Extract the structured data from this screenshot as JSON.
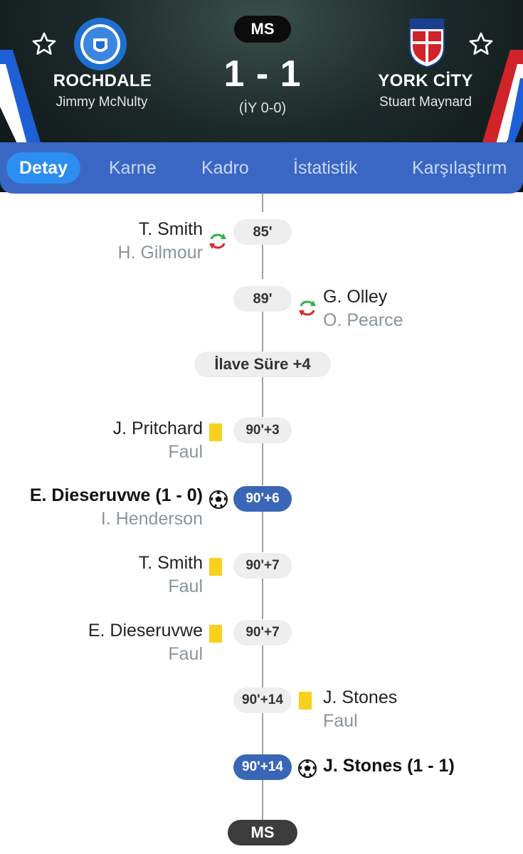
{
  "match": {
    "status": "MS",
    "score": "1 - 1",
    "halftime": "(İY 0-0)",
    "home": {
      "name": "ROCHDALE",
      "coach": "Jimmy McNulty"
    },
    "away": {
      "name": "YORK CİTY",
      "coach": "Stuart Maynard"
    },
    "colors": {
      "home_stripe_blue": "#1f5fd6",
      "away_stripe_red": "#d1232a",
      "tab_bg": "#3b67c4",
      "tab_active": "#2b8ef0"
    }
  },
  "tabs": [
    {
      "label": "Detay",
      "active": true
    },
    {
      "label": "Karne"
    },
    {
      "label": "Kadro"
    },
    {
      "label": "İstatistik"
    },
    {
      "label": "Karşılaştırm"
    }
  ],
  "timeline": {
    "extra_time_label": "İlave Süre +4",
    "end_label": "MS",
    "events": [
      {
        "minute": "85'",
        "side": "home",
        "type": "substitution",
        "player": "T. Smith",
        "detail": "H. Gilmour",
        "icon": "substitution-icon"
      },
      {
        "minute": "89'",
        "side": "away",
        "type": "substitution",
        "player": "G. Olley",
        "detail": "O. Pearce",
        "icon": "substitution-icon"
      },
      {
        "minute": "90'+3",
        "side": "home",
        "type": "yellow-card",
        "player": "J. Pritchard",
        "detail": "Faul",
        "icon": "yellow-card-icon"
      },
      {
        "minute": "90'+6",
        "side": "home",
        "type": "goal",
        "player": "E. Dieseruvwe (1 - 0)",
        "detail": "I. Henderson",
        "icon": "soccer-ball-icon"
      },
      {
        "minute": "90'+7",
        "side": "home",
        "type": "yellow-card",
        "player": "T. Smith",
        "detail": "Faul",
        "icon": "yellow-card-icon"
      },
      {
        "minute": "90'+7",
        "side": "home",
        "type": "yellow-card",
        "player": "E. Dieseruvwe",
        "detail": "Faul",
        "icon": "yellow-card-icon"
      },
      {
        "minute": "90'+14",
        "side": "away",
        "type": "yellow-card",
        "player": "J. Stones",
        "detail": "Faul",
        "icon": "yellow-card-icon"
      },
      {
        "minute": "90'+14",
        "side": "away",
        "type": "goal",
        "player": "J. Stones (1 - 1)",
        "detail": "",
        "icon": "soccer-ball-icon"
      }
    ]
  }
}
